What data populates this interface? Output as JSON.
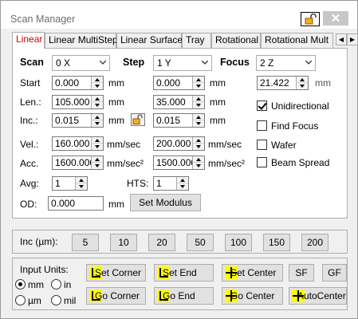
{
  "window": {
    "title": "Scan Manager",
    "accent_color": "#d00000",
    "lock_icon": "open-padlock-icon",
    "close_glyph": "✕"
  },
  "tabs": [
    "Linear",
    "Linear MultiStep",
    "Linear Surface",
    "Tray",
    "Rotational",
    "Rotational Mult"
  ],
  "tab_scroll": {
    "left": "◀",
    "right": "▶"
  },
  "linear": {
    "scan_label": "Scan",
    "scan_axis": "0 X",
    "step_label": "Step",
    "step_axis": "1 Y",
    "focus_label": "Focus",
    "focus_axis": "2 Z",
    "start_label": "Start",
    "len_label": "Len.:",
    "inc_label": "Inc.:",
    "vel_label": "Vel.:",
    "acc_label": "Acc.",
    "avg_label": "Avg:",
    "hts_label": "HTS:",
    "od_label": "OD:",
    "scan_start": "0.000",
    "scan_len": "105.000",
    "scan_inc": "0.015",
    "step_start": "0.000",
    "step_len": "35.000",
    "step_inc": "0.015",
    "focus_start": "21.422",
    "vel_scan": "160.000",
    "vel_step": "200.000",
    "acc_scan": "1600.000",
    "acc_step": "1500.000",
    "avg": "1",
    "hts": "1",
    "od": "0.000",
    "unit_mm": "mm",
    "unit_mm_sec": "mm/sec",
    "unit_mm_sec2": "mm/sec²",
    "set_modulus_label": "Set Modulus",
    "checkboxes": [
      {
        "label": "Unidirectional",
        "checked": true
      },
      {
        "label": "Find Focus",
        "checked": false
      },
      {
        "label": "Wafer",
        "checked": false
      },
      {
        "label": "Beam Spread",
        "checked": false
      }
    ]
  },
  "increments": {
    "label": "Inc (µm):",
    "values": [
      "5",
      "10",
      "20",
      "50",
      "100",
      "150",
      "200"
    ]
  },
  "input_units": {
    "label": "Input Units:",
    "options": [
      {
        "label": "mm",
        "selected": true
      },
      {
        "label": "in",
        "selected": false
      },
      {
        "label": "µm",
        "selected": false
      },
      {
        "label": "mil",
        "selected": false
      }
    ]
  },
  "actions": {
    "set_corner": "Set Corner",
    "set_end": "Set End",
    "set_center": "Set Center",
    "sf": "SF",
    "gf": "GF",
    "go_corner": "Go Corner",
    "go_end": "Go End",
    "go_center": "Go Center",
    "auto_center": "AutoCenter",
    "icon_color": "#ffff00"
  }
}
